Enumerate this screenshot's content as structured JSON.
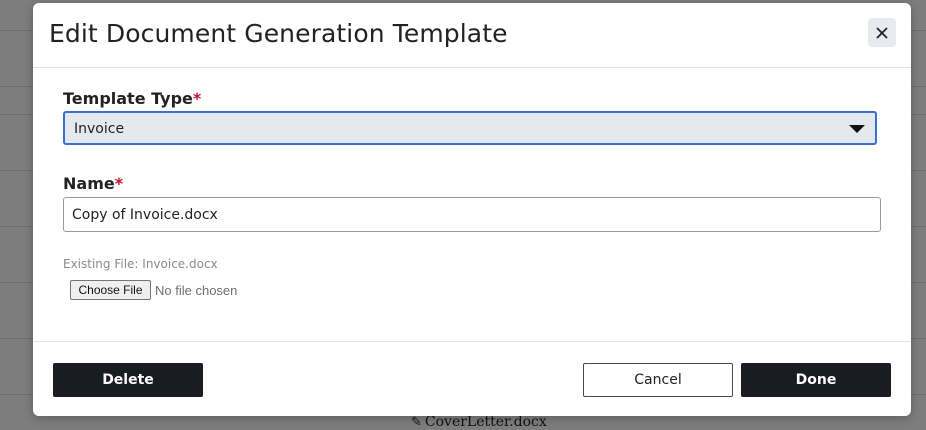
{
  "backdrop": {
    "file_link": "CoverLetter.docx",
    "pencil_glyph": "✎"
  },
  "modal": {
    "title": "Edit Document Generation Template",
    "close_glyph": "✕"
  },
  "form": {
    "template_type": {
      "label": "Template Type",
      "required_mark": "*",
      "selected": "Invoice"
    },
    "name": {
      "label": "Name",
      "required_mark": "*",
      "value": "Copy of Invoice.docx"
    },
    "existing_file": "Existing File: Invoice.docx",
    "file_input": {
      "button_label": "Choose File",
      "status": "No file chosen"
    }
  },
  "footer": {
    "delete_label": "Delete",
    "cancel_label": "Cancel",
    "done_label": "Done"
  },
  "colors": {
    "accent_border": "#3b6fd1",
    "required": "#c0132f",
    "dark_button": "#1a1b23"
  }
}
